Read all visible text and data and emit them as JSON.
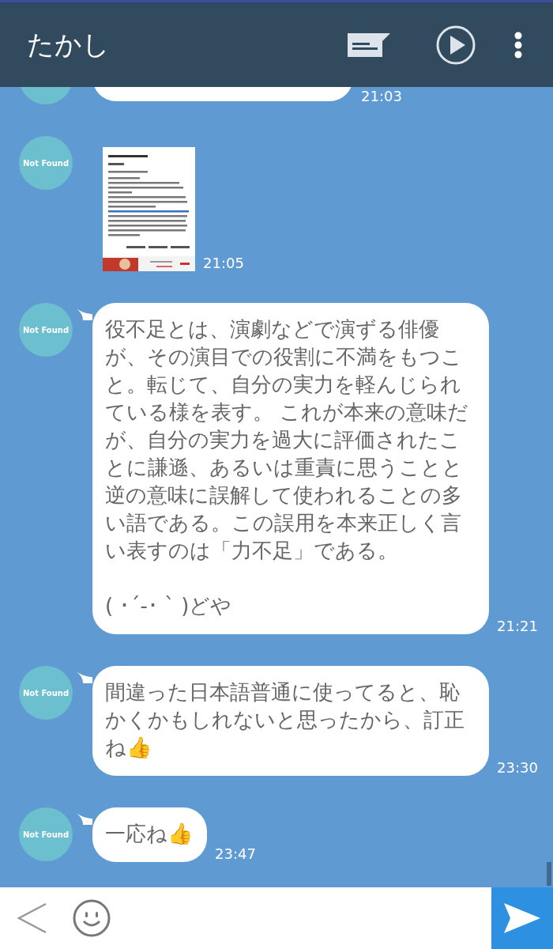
{
  "header": {
    "title": "たかし"
  },
  "messages": [
    {
      "kind": "text",
      "time": "21:03"
    },
    {
      "avatar_text": "Not Found",
      "time": "21:05"
    },
    {
      "kind": "text",
      "avatar_text": "Not Found",
      "text": "役不足とは、演劇などで演ずる俳優が、その演目での役割に不満をもつこと。転じて、自分の実力を軽んじられている様を表す。 これが本来の意味だが、自分の実力を過大に評価されたことに謙遜、あるいは重責に思うことと逆の意味に誤解して使われることの多い語である。この誤用を本来正しく言い表すのは「力不足」である。\n\n( ･´-･ ` )どや",
      "time": "21:21"
    },
    {
      "kind": "text",
      "avatar_text": "Not Found",
      "text": "間違った日本語普通に使ってると、恥かくかもしれないと思ったから、訂正ね👍",
      "time": "23:30"
    },
    {
      "kind": "text",
      "avatar_text": "Not Found",
      "text": "一応ね👍",
      "time": "23:47"
    }
  ]
}
